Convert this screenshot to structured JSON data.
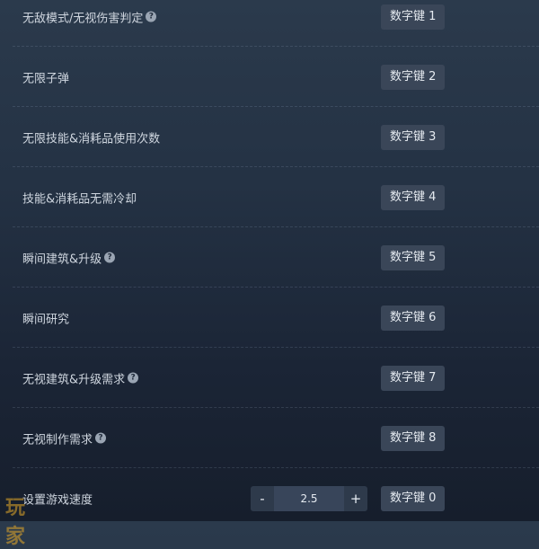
{
  "rows": [
    {
      "label": "无敌模式/无视伤害判定",
      "help": true,
      "hotkey": "数字键 1"
    },
    {
      "label": "无限子弹",
      "help": false,
      "hotkey": "数字键 2"
    },
    {
      "label": "无限技能&消耗品使用次数",
      "help": false,
      "hotkey": "数字键 3"
    },
    {
      "label": "技能&消耗品无需冷却",
      "help": false,
      "hotkey": "数字键 4"
    },
    {
      "label": "瞬间建筑&升级",
      "help": true,
      "hotkey": "数字键 5"
    },
    {
      "label": "瞬间研究",
      "help": false,
      "hotkey": "数字键 6"
    },
    {
      "label": "无视建筑&升级需求",
      "help": true,
      "hotkey": "数字键 7"
    },
    {
      "label": "无视制作需求",
      "help": true,
      "hotkey": "数字键 8"
    },
    {
      "label": "设置游戏速度",
      "help": false,
      "hotkey": "数字键 0"
    }
  ],
  "speed": {
    "minus": "-",
    "value": "2.5",
    "plus": "+"
  },
  "help_glyph": "?",
  "watermark": {
    "text": "玩家"
  },
  "colors": {
    "background_top": "#2b3a4c",
    "background_bottom": "#161e2c",
    "hotkey_bg": "#3a4658",
    "watermark": "#e6aa28"
  },
  "icons": {
    "help": "question-circle-icon"
  }
}
